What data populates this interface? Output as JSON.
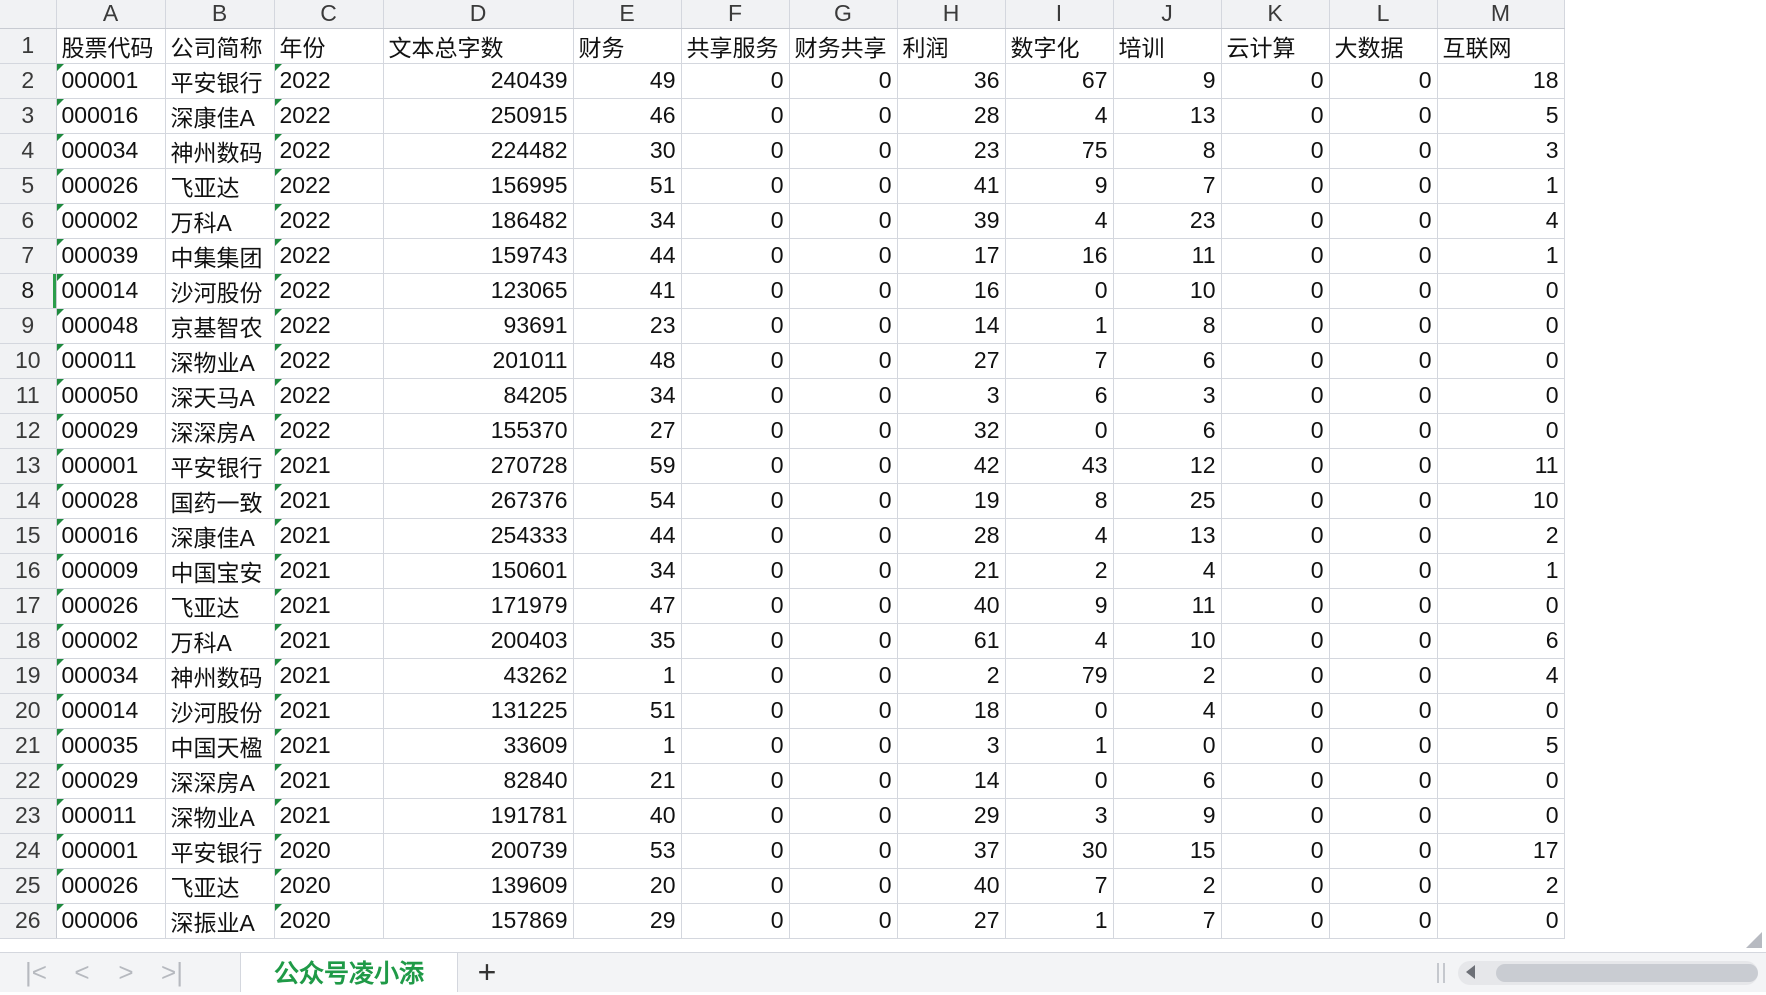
{
  "columns": [
    "A",
    "B",
    "C",
    "D",
    "E",
    "F",
    "G",
    "H",
    "I",
    "J",
    "K",
    "L",
    "M"
  ],
  "header_row": {
    "row_number": "1",
    "cells": [
      "股票代码",
      "公司简称",
      "年份",
      "文本总字数",
      "财务",
      "共享服务",
      "财务共享",
      "利润",
      "数字化",
      "培训",
      "云计算",
      "大数据",
      "互联网"
    ]
  },
  "rows": [
    {
      "n": "2",
      "cells": [
        "000001",
        "平安银行",
        "2022",
        "240439",
        "49",
        "0",
        "0",
        "36",
        "67",
        "9",
        "0",
        "0",
        "18"
      ]
    },
    {
      "n": "3",
      "cells": [
        "000016",
        "深康佳A",
        "2022",
        "250915",
        "46",
        "0",
        "0",
        "28",
        "4",
        "13",
        "0",
        "0",
        "5"
      ]
    },
    {
      "n": "4",
      "cells": [
        "000034",
        "神州数码",
        "2022",
        "224482",
        "30",
        "0",
        "0",
        "23",
        "75",
        "8",
        "0",
        "0",
        "3"
      ]
    },
    {
      "n": "5",
      "cells": [
        "000026",
        "飞亚达",
        "2022",
        "156995",
        "51",
        "0",
        "0",
        "41",
        "9",
        "7",
        "0",
        "0",
        "1"
      ]
    },
    {
      "n": "6",
      "cells": [
        "000002",
        "万科A",
        "2022",
        "186482",
        "34",
        "0",
        "0",
        "39",
        "4",
        "23",
        "0",
        "0",
        "4"
      ]
    },
    {
      "n": "7",
      "cells": [
        "000039",
        "中集集团",
        "2022",
        "159743",
        "44",
        "0",
        "0",
        "17",
        "16",
        "11",
        "0",
        "0",
        "1"
      ]
    },
    {
      "n": "8",
      "cells": [
        "000014",
        "沙河股份",
        "2022",
        "123065",
        "41",
        "0",
        "0",
        "16",
        "0",
        "10",
        "0",
        "0",
        "0"
      ]
    },
    {
      "n": "9",
      "cells": [
        "000048",
        "京基智农",
        "2022",
        "93691",
        "23",
        "0",
        "0",
        "14",
        "1",
        "8",
        "0",
        "0",
        "0"
      ]
    },
    {
      "n": "10",
      "cells": [
        "000011",
        "深物业A",
        "2022",
        "201011",
        "48",
        "0",
        "0",
        "27",
        "7",
        "6",
        "0",
        "0",
        "0"
      ]
    },
    {
      "n": "11",
      "cells": [
        "000050",
        "深天马A",
        "2022",
        "84205",
        "34",
        "0",
        "0",
        "3",
        "6",
        "3",
        "0",
        "0",
        "0"
      ]
    },
    {
      "n": "12",
      "cells": [
        "000029",
        "深深房A",
        "2022",
        "155370",
        "27",
        "0",
        "0",
        "32",
        "0",
        "6",
        "0",
        "0",
        "0"
      ]
    },
    {
      "n": "13",
      "cells": [
        "000001",
        "平安银行",
        "2021",
        "270728",
        "59",
        "0",
        "0",
        "42",
        "43",
        "12",
        "0",
        "0",
        "11"
      ]
    },
    {
      "n": "14",
      "cells": [
        "000028",
        "国药一致",
        "2021",
        "267376",
        "54",
        "0",
        "0",
        "19",
        "8",
        "25",
        "0",
        "0",
        "10"
      ]
    },
    {
      "n": "15",
      "cells": [
        "000016",
        "深康佳A",
        "2021",
        "254333",
        "44",
        "0",
        "0",
        "28",
        "4",
        "13",
        "0",
        "0",
        "2"
      ]
    },
    {
      "n": "16",
      "cells": [
        "000009",
        "中国宝安",
        "2021",
        "150601",
        "34",
        "0",
        "0",
        "21",
        "2",
        "4",
        "0",
        "0",
        "1"
      ]
    },
    {
      "n": "17",
      "cells": [
        "000026",
        "飞亚达",
        "2021",
        "171979",
        "47",
        "0",
        "0",
        "40",
        "9",
        "11",
        "0",
        "0",
        "0"
      ]
    },
    {
      "n": "18",
      "cells": [
        "000002",
        "万科A",
        "2021",
        "200403",
        "35",
        "0",
        "0",
        "61",
        "4",
        "10",
        "0",
        "0",
        "6"
      ]
    },
    {
      "n": "19",
      "cells": [
        "000034",
        "神州数码",
        "2021",
        "43262",
        "1",
        "0",
        "0",
        "2",
        "79",
        "2",
        "0",
        "0",
        "4"
      ]
    },
    {
      "n": "20",
      "cells": [
        "000014",
        "沙河股份",
        "2021",
        "131225",
        "51",
        "0",
        "0",
        "18",
        "0",
        "4",
        "0",
        "0",
        "0"
      ]
    },
    {
      "n": "21",
      "cells": [
        "000035",
        "中国天楹",
        "2021",
        "33609",
        "1",
        "0",
        "0",
        "3",
        "1",
        "0",
        "0",
        "0",
        "5"
      ]
    },
    {
      "n": "22",
      "cells": [
        "000029",
        "深深房A",
        "2021",
        "82840",
        "21",
        "0",
        "0",
        "14",
        "0",
        "6",
        "0",
        "0",
        "0"
      ]
    },
    {
      "n": "23",
      "cells": [
        "000011",
        "深物业A",
        "2021",
        "191781",
        "40",
        "0",
        "0",
        "29",
        "3",
        "9",
        "0",
        "0",
        "0"
      ]
    },
    {
      "n": "24",
      "cells": [
        "000001",
        "平安银行",
        "2020",
        "200739",
        "53",
        "0",
        "0",
        "37",
        "30",
        "15",
        "0",
        "0",
        "17"
      ]
    },
    {
      "n": "25",
      "cells": [
        "000026",
        "飞亚达",
        "2020",
        "139609",
        "20",
        "0",
        "0",
        "40",
        "7",
        "2",
        "0",
        "0",
        "2"
      ]
    },
    {
      "n": "26",
      "cells": [
        "000006",
        "深振业A",
        "2020",
        "157869",
        "29",
        "0",
        "0",
        "27",
        "1",
        "7",
        "0",
        "0",
        "0"
      ]
    }
  ],
  "selected_row": "8",
  "tabbar": {
    "nav_icons": [
      "first-sheet-icon",
      "prev-sheet-icon",
      "next-sheet-icon",
      "last-sheet-icon"
    ],
    "nav_glyphs": [
      "|<",
      "<",
      ">",
      ">|"
    ],
    "sheet_tab_label": "公众号凌小添",
    "add_sheet_glyph": "+"
  },
  "colors": {
    "accent_green": "#1f9a47",
    "gridline": "#d4d7de",
    "header_bg": "#f1f2f4"
  }
}
